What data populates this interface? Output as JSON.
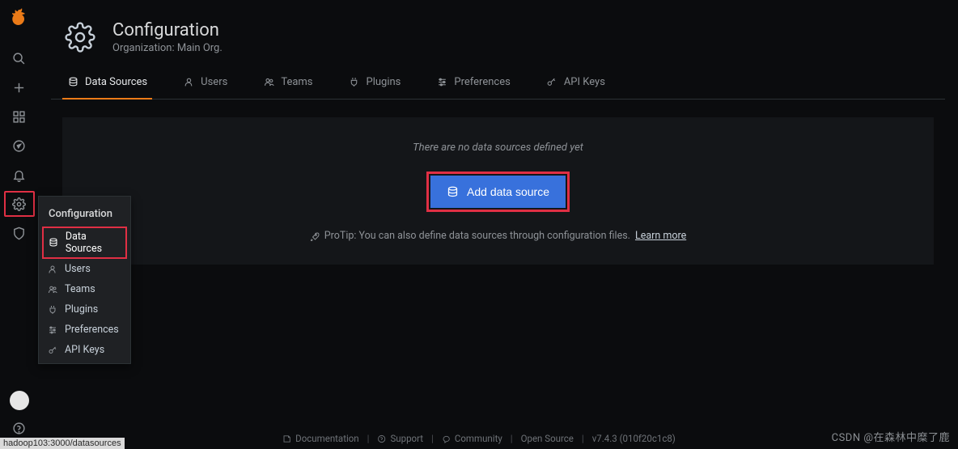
{
  "page": {
    "title": "Configuration",
    "subtitle": "Organization: Main Org."
  },
  "tabs": [
    {
      "label": "Data Sources"
    },
    {
      "label": "Users"
    },
    {
      "label": "Teams"
    },
    {
      "label": "Plugins"
    },
    {
      "label": "Preferences"
    },
    {
      "label": "API Keys"
    }
  ],
  "flyout": {
    "title": "Configuration",
    "items": [
      {
        "label": "Data Sources"
      },
      {
        "label": "Users"
      },
      {
        "label": "Teams"
      },
      {
        "label": "Plugins"
      },
      {
        "label": "Preferences"
      },
      {
        "label": "API Keys"
      }
    ]
  },
  "panel": {
    "empty": "There are no data sources defined yet",
    "add_label": "Add data source",
    "pro_prefix": "ProTip: You can also define data sources through configuration files.",
    "learn_more": "Learn more"
  },
  "footer": {
    "doc": "Documentation",
    "support": "Support",
    "community": "Community",
    "open_source": "Open Source",
    "version": "v7.4.3 (010f20c1c8)"
  },
  "status_url": "hadoop103:3000/datasources",
  "watermark": "CSDN @在森林中糜了鹿"
}
